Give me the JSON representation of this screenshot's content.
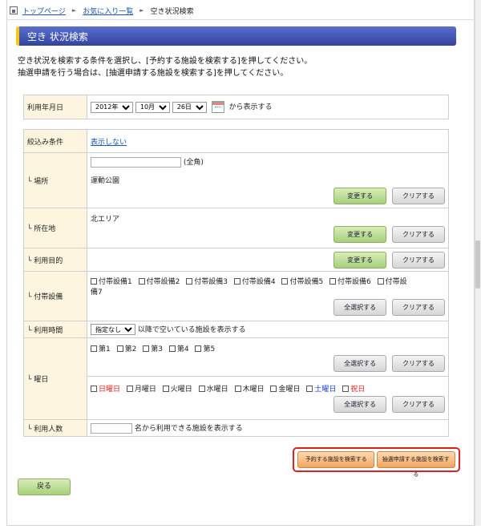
{
  "breadcrumb": {
    "home": "トップページ",
    "favorites": "お気に入り一覧",
    "current": "空き状況検索"
  },
  "page_title": "空き 状況検索",
  "intro": {
    "line1": "空き状況を検索する条件を選択し、[予約する施設を検索する]を押してください。",
    "line2": "抽選申請を行う場合は、[抽選申請する施設を検索する]を押してください。"
  },
  "date_row": {
    "label": "利用年月日",
    "year": "2012年",
    "month": "10月",
    "day": "26日",
    "suffix": "から表示する"
  },
  "filter": {
    "label": "絞込み条件",
    "toggle_link": "表示しない"
  },
  "place": {
    "label": "└ 場所",
    "input_value": "",
    "input_note": "(全角)",
    "value": "運動公園"
  },
  "location": {
    "label": "└ 所在地",
    "value": "北エリア"
  },
  "purpose": {
    "label": "└ 利用目的"
  },
  "equipment": {
    "label": "└ 付帯設備",
    "items": [
      "付帯設備1",
      "付帯設備2",
      "付帯設備3",
      "付帯設備4",
      "付帯設備5",
      "付帯設備6"
    ],
    "item7_a": "付帯設",
    "item7_b": "備7"
  },
  "time": {
    "label": "└ 利用時間",
    "select_value": "指定なし",
    "suffix": "以降で空いている施設を表示する"
  },
  "weekday": {
    "label": "└ 曜日",
    "weeks": [
      "第1",
      "第2",
      "第3",
      "第4",
      "第5"
    ],
    "days": [
      "日曜日",
      "月曜日",
      "火曜日",
      "水曜日",
      "木曜日",
      "金曜日",
      "土曜日",
      "祝日"
    ]
  },
  "people": {
    "label": "└ 利用人数",
    "input_value": "",
    "suffix": "名から利用できる施設を表示する"
  },
  "buttons": {
    "change": "変更する",
    "clear": "クリアする",
    "select_all": "全選択する",
    "search_reserve": "予約する施設を検索する",
    "search_lottery": "抽選申請する施設を検索する",
    "back": "戻る"
  },
  "colors": {
    "title_bar": "#3d4fb0",
    "label_bg": "#fdf5df",
    "highlight": "#e02020",
    "sunday": "#e02020",
    "saturday": "#1a40d0",
    "holiday": "#e02020"
  }
}
